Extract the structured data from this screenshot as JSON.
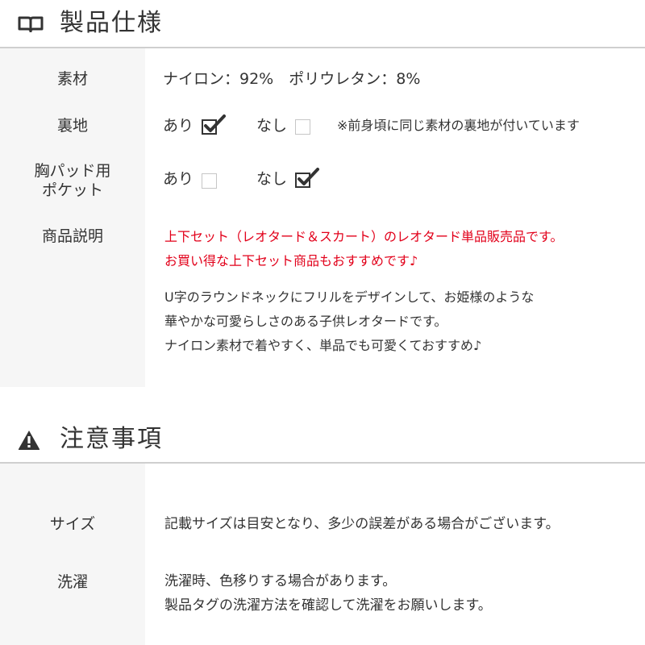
{
  "spec_section": {
    "title": "製品仕様",
    "icon": "open-book-icon",
    "rows": {
      "material": {
        "label": "素材",
        "value": "ナイロン：92%　ポリウレタン：8%"
      },
      "lining": {
        "label": "裏地",
        "yes_label": "あり",
        "yes_checked": true,
        "no_label": "なし",
        "no_checked": false,
        "note": "※前身頃に同じ素材の裏地が付いています"
      },
      "bra_pocket": {
        "label_line1": "胸パッド用",
        "label_line2": "ポケット",
        "yes_label": "あり",
        "yes_checked": false,
        "no_label": "なし",
        "no_checked": true
      },
      "description": {
        "label": "商品説明",
        "red_line1": "上下セット（レオタード＆スカート）のレオタード単品販売品です。",
        "red_line2": "お買い得な上下セット商品もおすすめです♪",
        "line1": "U字のラウンドネックにフリルをデザインして、お姫様のような",
        "line2": "華やかな可愛らしさのある子供レオタードです。",
        "line3": "ナイロン素材で着やすく、単品でも可愛くておすすめ♪"
      }
    }
  },
  "caution_section": {
    "title": "注意事項",
    "icon": "warning-icon",
    "rows": {
      "size": {
        "label": "サイズ",
        "value": "記載サイズは目安となり、多少の誤差がある場合がございます。"
      },
      "washing": {
        "label": "洗濯",
        "line1": "洗濯時、色移りする場合があります。",
        "line2": "製品タグの洗濯方法を確認して洗濯をお願いします。"
      }
    }
  },
  "colors": {
    "text": "#333333",
    "accent_red": "#e2001a",
    "label_bg": "#f6f6f6",
    "rule": "#cfcfcf"
  }
}
